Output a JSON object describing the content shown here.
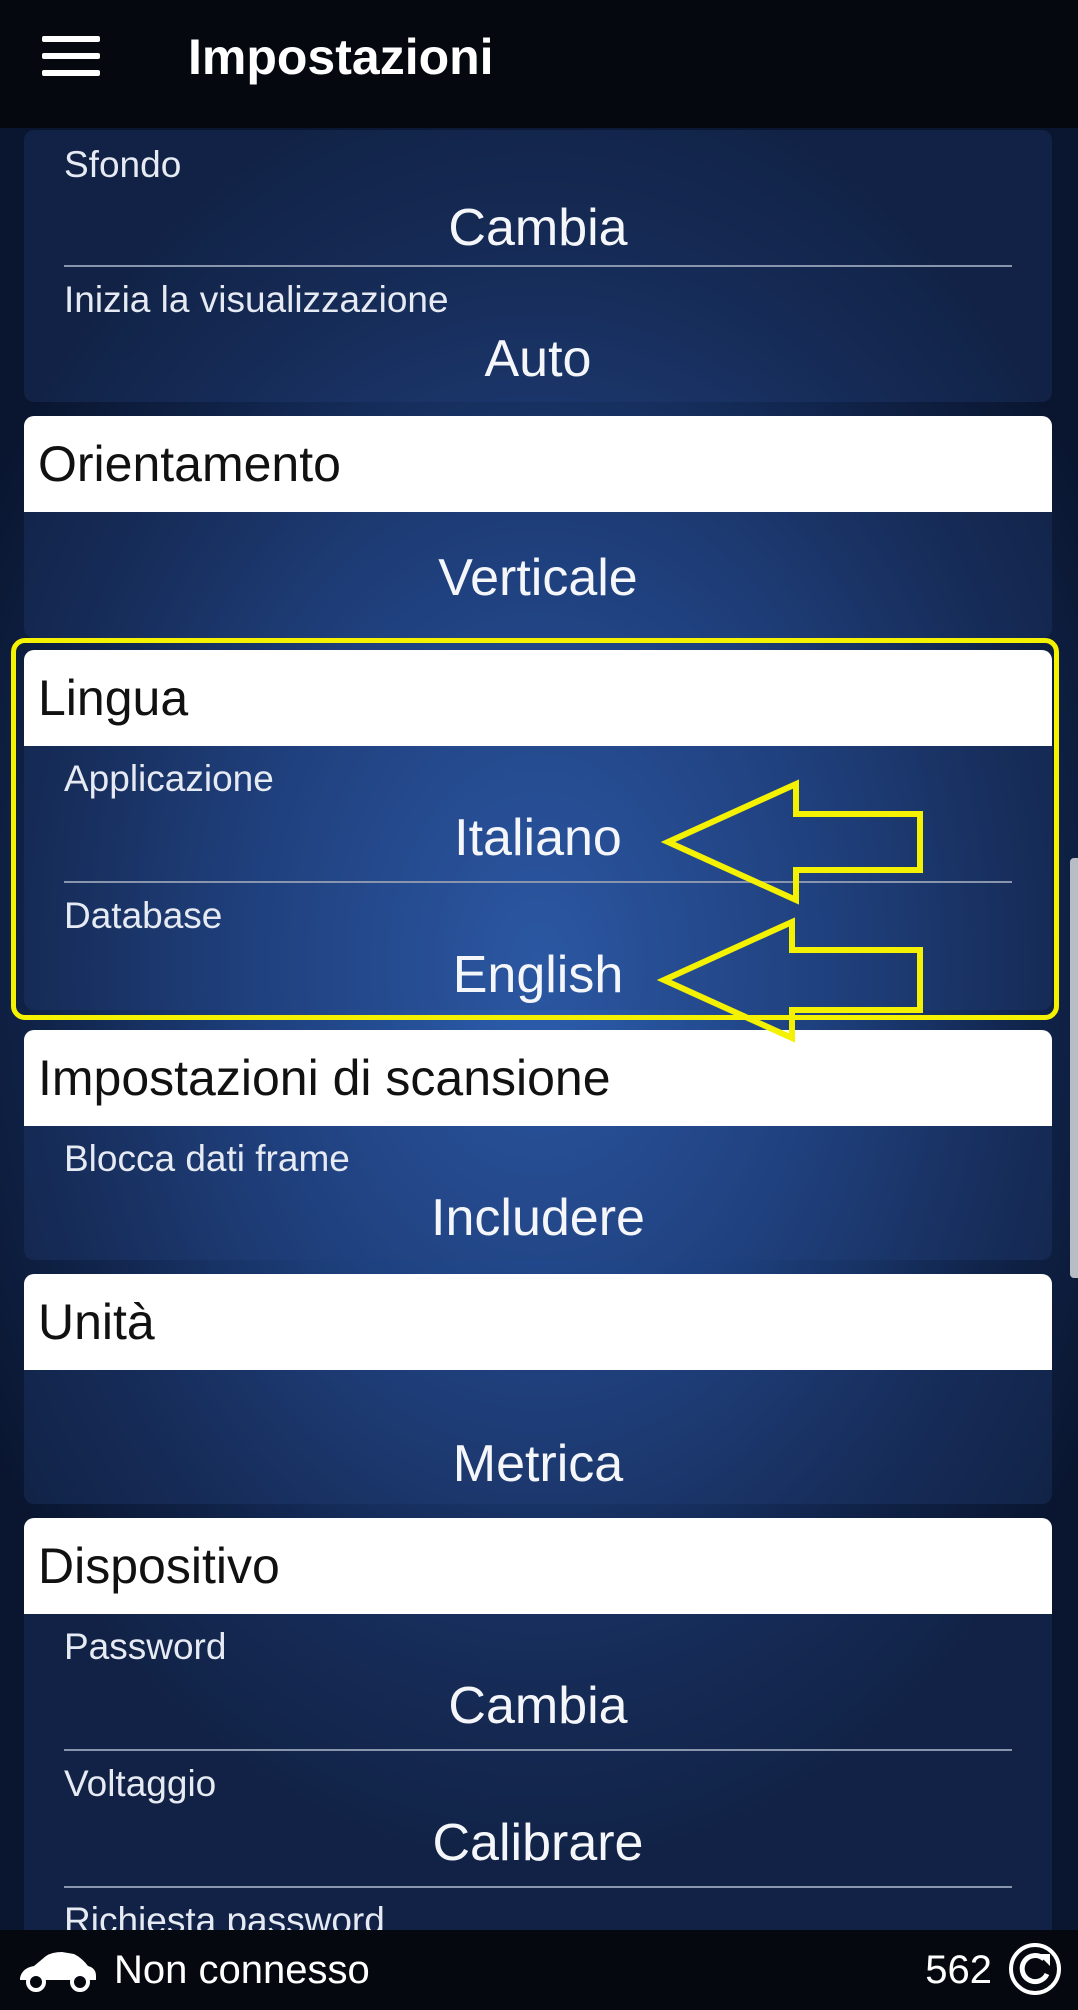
{
  "header": {
    "title": "Impostazioni",
    "menu_icon": "hamburger-menu-icon"
  },
  "sections": {
    "display": {
      "rows": [
        {
          "label": "Sfondo",
          "value": "Cambia"
        },
        {
          "label": "Inizia la visualizzazione",
          "value": "Auto"
        }
      ]
    },
    "orientation": {
      "title": "Orientamento",
      "value": "Verticale"
    },
    "language": {
      "title": "Lingua",
      "rows": [
        {
          "label": "Applicazione",
          "value": "Italiano"
        },
        {
          "label": "Database",
          "value": "English"
        }
      ]
    },
    "scan": {
      "title": "Impostazioni di scansione",
      "rows": [
        {
          "label": "Blocca dati frame",
          "value": "Includere"
        }
      ]
    },
    "units": {
      "title": "Unità",
      "value": "Metrica"
    },
    "device": {
      "title": "Dispositivo",
      "rows": [
        {
          "label": "Password",
          "value": "Cambia"
        },
        {
          "label": "Voltaggio",
          "value": "Calibrare"
        },
        {
          "label": "Richiesta password",
          "value": ""
        }
      ]
    }
  },
  "annotations": {
    "highlight_color": "#f4f200"
  },
  "status": {
    "connection": "Non connesso",
    "counter": "562",
    "car_icon": "car-icon",
    "refresh_icon": "refresh-icon"
  }
}
